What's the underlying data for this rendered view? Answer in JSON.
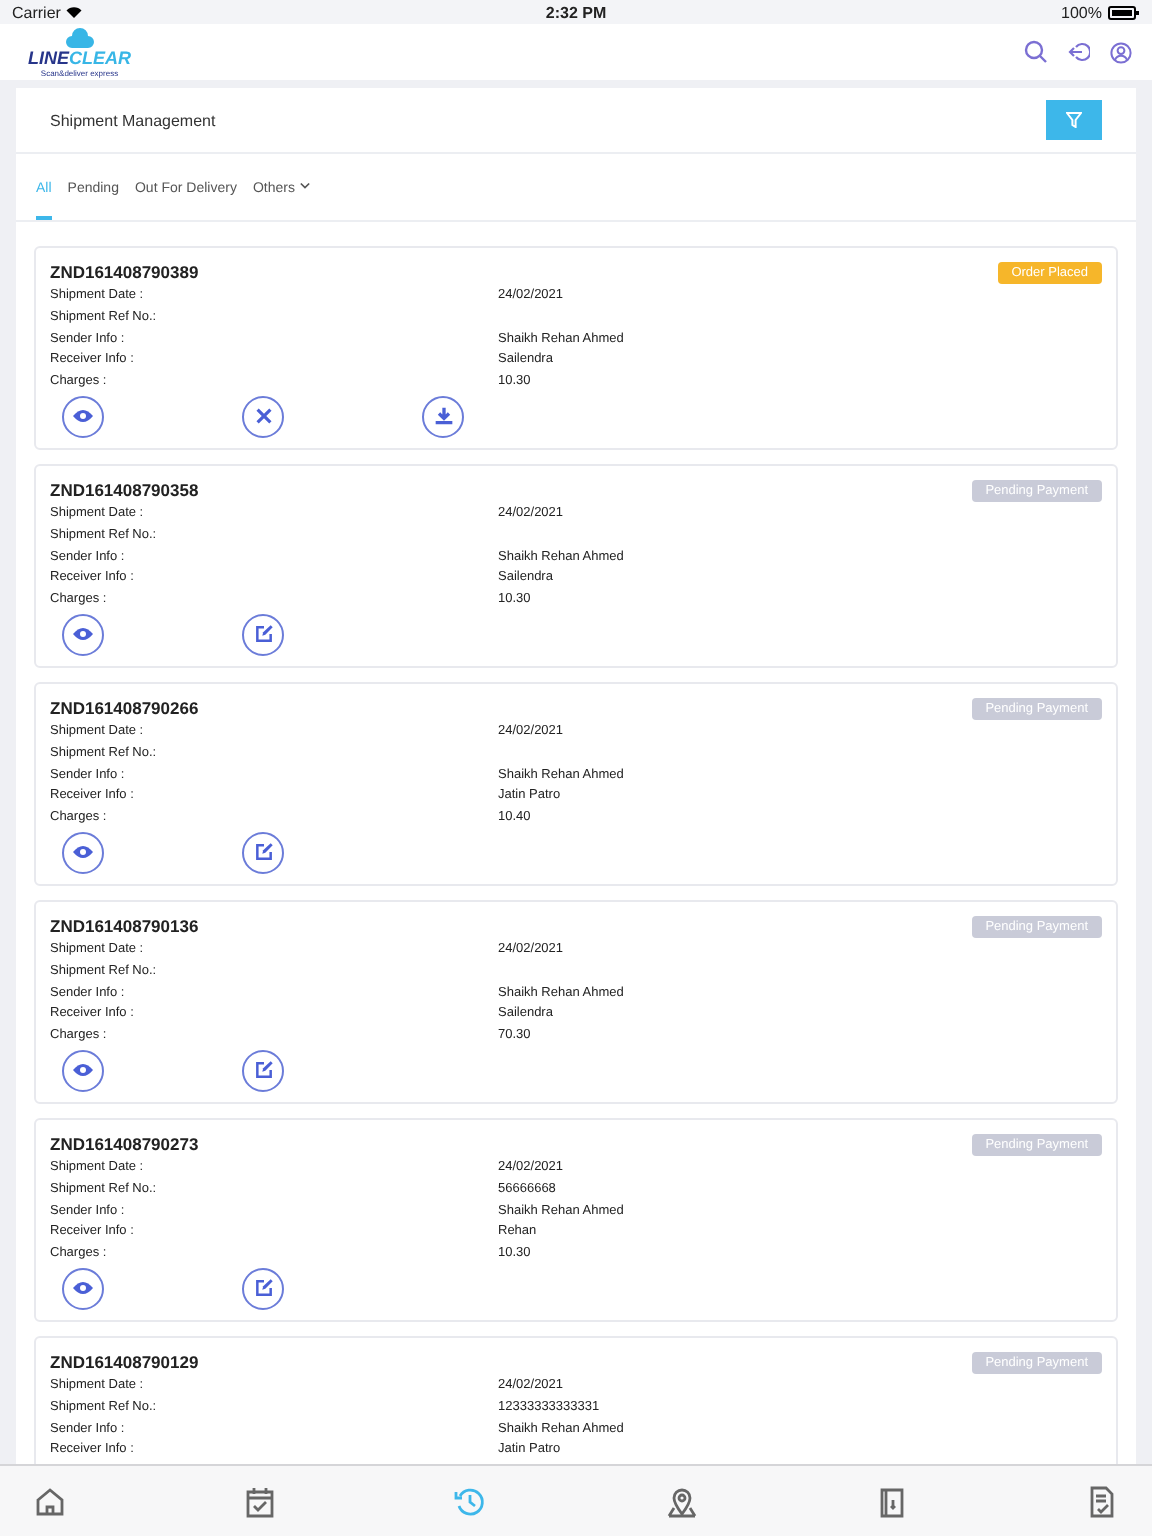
{
  "status_bar": {
    "carrier": "Carrier",
    "time": "2:32 PM",
    "battery": "100%"
  },
  "header": {
    "logo": {
      "word_a": "LINE",
      "word_b": "CLEAR",
      "tagline": "Scan&deliver express"
    }
  },
  "page": {
    "title": "Shipment Management"
  },
  "tabs": [
    {
      "label": "All",
      "selected": true,
      "dropdown": false
    },
    {
      "label": "Pending",
      "selected": false,
      "dropdown": false
    },
    {
      "label": "Out For Delivery",
      "selected": false,
      "dropdown": false
    },
    {
      "label": "Others",
      "selected": false,
      "dropdown": true
    }
  ],
  "shipments": [
    {
      "id": "ZND161408790389",
      "status": {
        "label": "Order Placed",
        "kind": "placed"
      },
      "fields": [
        {
          "label": "Shipment Date :",
          "value": "24/02/2021"
        },
        {
          "label": "Shipment Ref No.:"
        },
        {
          "label": "Sender Info :",
          "value": "Shaikh Rehan Ahmed"
        },
        {
          "label": "Receiver Info :",
          "value": "Sailendra"
        },
        {
          "label": "Charges :",
          "value": "10.30"
        }
      ],
      "actions": [
        {
          "kind": "view"
        },
        {
          "kind": "cancel"
        },
        {
          "kind": "download"
        }
      ]
    },
    {
      "id": "ZND161408790358",
      "status": {
        "label": "Pending Payment",
        "kind": "pending"
      },
      "fields": [
        {
          "label": "Shipment Date :",
          "value": "24/02/2021"
        },
        {
          "label": "Shipment Ref No.:"
        },
        {
          "label": "Sender Info :",
          "value": "Shaikh Rehan Ahmed"
        },
        {
          "label": "Receiver Info :",
          "value": "Sailendra"
        },
        {
          "label": "Charges :",
          "value": "10.30"
        }
      ],
      "actions": [
        {
          "kind": "view"
        },
        {
          "kind": "edit"
        }
      ]
    },
    {
      "id": "ZND161408790266",
      "status": {
        "label": "Pending Payment",
        "kind": "pending"
      },
      "fields": [
        {
          "label": "Shipment Date :",
          "value": "24/02/2021"
        },
        {
          "label": "Shipment Ref No.:"
        },
        {
          "label": "Sender Info :",
          "value": "Shaikh Rehan Ahmed"
        },
        {
          "label": "Receiver Info :",
          "value": "Jatin Patro"
        },
        {
          "label": "Charges :",
          "value": "10.40"
        }
      ],
      "actions": [
        {
          "kind": "view"
        },
        {
          "kind": "edit"
        }
      ]
    },
    {
      "id": "ZND161408790136",
      "status": {
        "label": "Pending Payment",
        "kind": "pending"
      },
      "fields": [
        {
          "label": "Shipment Date :",
          "value": "24/02/2021"
        },
        {
          "label": "Shipment Ref No.:"
        },
        {
          "label": "Sender Info :",
          "value": "Shaikh Rehan Ahmed"
        },
        {
          "label": "Receiver Info :",
          "value": "Sailendra"
        },
        {
          "label": "Charges :",
          "value": "70.30"
        }
      ],
      "actions": [
        {
          "kind": "view"
        },
        {
          "kind": "edit"
        }
      ]
    },
    {
      "id": "ZND161408790273",
      "status": {
        "label": "Pending Payment",
        "kind": "pending"
      },
      "fields": [
        {
          "label": "Shipment Date :",
          "value": "24/02/2021"
        },
        {
          "label": "Shipment Ref No.:",
          "value": "56666668"
        },
        {
          "label": "Sender Info :",
          "value": "Shaikh Rehan Ahmed"
        },
        {
          "label": "Receiver Info :",
          "value": "Rehan"
        },
        {
          "label": "Charges :",
          "value": "10.30"
        }
      ],
      "actions": [
        {
          "kind": "view"
        },
        {
          "kind": "edit"
        }
      ]
    },
    {
      "id": "ZND161408790129",
      "status": {
        "label": "Pending Payment",
        "kind": "pending"
      },
      "fields": [
        {
          "label": "Shipment Date :",
          "value": "24/02/2021"
        },
        {
          "label": "Shipment Ref No.:",
          "value": "12333333333331"
        },
        {
          "label": "Sender Info :",
          "value": "Shaikh Rehan Ahmed"
        },
        {
          "label": "Receiver Info :",
          "value": "Jatin Patro"
        }
      ]
    }
  ],
  "bottom_nav": [
    {
      "kind": "home",
      "selected": false
    },
    {
      "kind": "calendar",
      "selected": false
    },
    {
      "kind": "history",
      "selected": true
    },
    {
      "kind": "pin",
      "selected": false
    },
    {
      "kind": "document",
      "selected": false
    },
    {
      "kind": "clipboard",
      "selected": false
    }
  ]
}
